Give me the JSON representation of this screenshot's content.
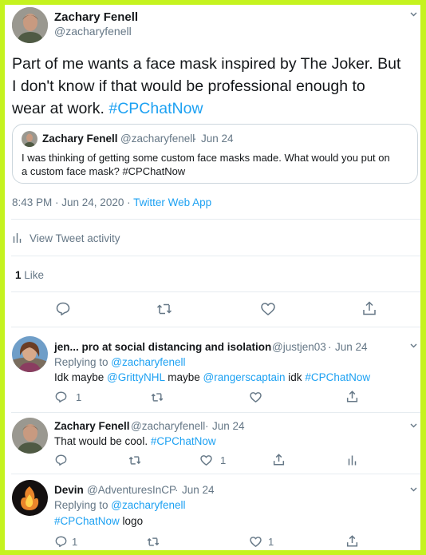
{
  "main_tweet": {
    "author_name": "Zachary Fenell",
    "author_handle": "@zacharyfenell",
    "text_lines": [
      "Part of me wants a face mask inspired by The Joker. But",
      "I don't know if that would be professional enough to",
      "wear at work. "
    ],
    "hashtag": "#CPChatNow",
    "quoted": {
      "author_name": "Zachary Fenell",
      "author_handle": "@zacharyfenell",
      "date": "Jun 24",
      "text_line1": "I was thinking of getting some custom face masks made. What would you put on",
      "text_line2": "a custom face mask? #CPChatNow"
    },
    "timestamp": "8:43 PM · Jun 24, 2020 · ",
    "source": "Twitter Web App",
    "activity_label": "View Tweet activity",
    "likes_count": "1",
    "likes_label": "Like"
  },
  "replies": [
    {
      "author_name": "jen... pro at social distancing and isolation",
      "author_handle": "@justjen03",
      "date": "Jun 24",
      "replying_label": "Replying to ",
      "replying_to": "@zacharyfenell",
      "text_parts": [
        "Idk maybe ",
        "@GrittyNHL",
        " maybe ",
        "@rangerscaptain",
        " idk ",
        "#CPChatNow"
      ],
      "reply_count": "1",
      "like_count": ""
    },
    {
      "author_name": "Zachary Fenell",
      "author_handle": "@zacharyfenell",
      "date": "Jun 24",
      "text_parts": [
        "That would be cool. ",
        "#CPChatNow"
      ],
      "reply_count": "",
      "like_count": "1"
    },
    {
      "author_name": "Devin",
      "author_handle": "@AdventuresInCP",
      "date": "Jun 24",
      "replying_label": "Replying to ",
      "replying_to": "@zacharyfenell",
      "text_parts": [
        "#CPChatNow",
        " logo"
      ],
      "reply_count": "1",
      "like_count": "1"
    }
  ],
  "colors": {
    "accent": "#1da1f2",
    "muted": "#657786",
    "border": "#e6ecf0",
    "frame": "#c5f31f"
  }
}
